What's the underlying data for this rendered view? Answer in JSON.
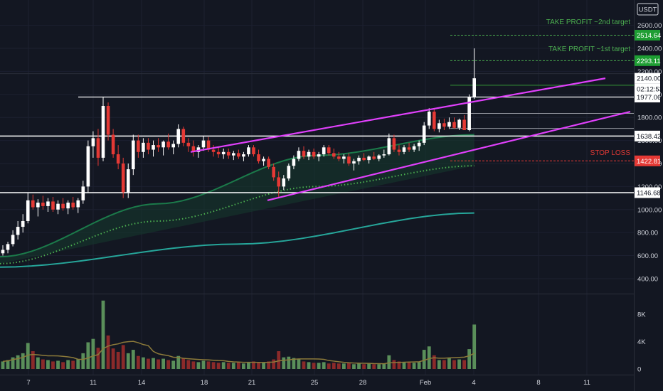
{
  "chart_data": {
    "type": "candlestick",
    "currency_label": "USDT",
    "y_ticks": [
      400,
      600,
      800,
      1000,
      1200,
      1400,
      1600,
      1800,
      2000,
      2200,
      2400,
      2600
    ],
    "y_tick_labels": [
      "400.00",
      "600.00",
      "800.00",
      "1000.00",
      "1200.00",
      "1400.00",
      "1600.00",
      "1800.00",
      "2000.00",
      "2200.00",
      "2400.00",
      "2600.00"
    ],
    "ylim": [
      270,
      2820
    ],
    "x_ticks": [
      "7",
      "11",
      "14",
      "18",
      "21",
      "25",
      "28",
      "Feb",
      "4",
      "8",
      "11"
    ],
    "volume_ticks": [
      "8K",
      "4K",
      "0"
    ],
    "volume_tick_values": [
      8000,
      4000,
      0
    ],
    "price_tags": [
      {
        "value": "2514.64",
        "color": "#1e9e33",
        "text_color": "#ffffff"
      },
      {
        "value": "2293.11",
        "color": "#1e9e33",
        "text_color": "#ffffff"
      },
      {
        "value": "2140.00",
        "color": "#ffffff",
        "text_color": "#131722"
      },
      {
        "value": "02:12:53",
        "color": "#ffffff",
        "text_color": "#131722"
      },
      {
        "value": "1977.06",
        "color": "#ffffff",
        "text_color": "#131722"
      },
      {
        "value": "1638.42",
        "color": "#ffffff",
        "text_color": "#131722"
      },
      {
        "value": "1422.81",
        "color": "#e53935",
        "text_color": "#ffffff"
      },
      {
        "value": "1146.68",
        "color": "#ffffff",
        "text_color": "#131722"
      }
    ],
    "annotations": {
      "take_profit_2": "TAKE PROFIT ~2nd target",
      "take_profit_1": "TAKE PROFIT ~1st target",
      "stop_loss": "STOP LOSS"
    },
    "levels": {
      "take_profit_2": 2514.64,
      "take_profit_1": 2293.11,
      "stop_loss": 1422.81,
      "horizontal_white": [
        1977.06,
        1638.42,
        1146.68
      ],
      "green_line": 2080
    },
    "colors": {
      "background": "#131722",
      "up": "#ffffff",
      "down": "#e53935",
      "channel": "#e040fb",
      "take_profit": "#4caf50",
      "stop_loss": "#e53935",
      "ema_long": "#26a69a",
      "ema_mid": "#1b7a4a",
      "ema_dotted": "#4caf50",
      "volume_up": "#5a8f5a",
      "volume_down": "#8b2a2a"
    },
    "series": [
      {
        "name": "EMA long",
        "values": [
          500,
          700,
          970
        ]
      },
      {
        "name": "EMA mid",
        "values": [
          590,
          1050,
          1470,
          1650
        ]
      },
      {
        "name": "EMA dotted",
        "values": [
          530,
          900,
          1200,
          1380
        ]
      }
    ],
    "candles": [
      [
        620,
        690,
        600,
        650
      ],
      [
        650,
        720,
        620,
        700
      ],
      [
        700,
        820,
        680,
        780
      ],
      [
        780,
        900,
        740,
        850
      ],
      [
        850,
        960,
        800,
        900
      ],
      [
        900,
        1150,
        880,
        1080
      ],
      [
        1080,
        1130,
        1000,
        1020
      ],
      [
        1020,
        1090,
        940,
        1060
      ],
      [
        1060,
        1120,
        1000,
        1030
      ],
      [
        1030,
        1100,
        980,
        1070
      ],
      [
        1070,
        1110,
        980,
        1000
      ],
      [
        1000,
        1080,
        960,
        1050
      ],
      [
        1050,
        1100,
        990,
        1010
      ],
      [
        1010,
        1080,
        960,
        1060
      ],
      [
        1060,
        1110,
        1000,
        1020
      ],
      [
        1020,
        1100,
        970,
        1080
      ],
      [
        1080,
        1250,
        1050,
        1200
      ],
      [
        1200,
        1600,
        1150,
        1550
      ],
      [
        1550,
        1680,
        1450,
        1620
      ],
      [
        1620,
        1700,
        1380,
        1450
      ],
      [
        1450,
        1980,
        1420,
        1900
      ],
      [
        1900,
        1930,
        1600,
        1650
      ],
      [
        1650,
        1700,
        1450,
        1480
      ],
      [
        1480,
        1560,
        1350,
        1400
      ],
      [
        1400,
        1450,
        1100,
        1150
      ],
      [
        1150,
        1400,
        1100,
        1350
      ],
      [
        1350,
        1650,
        1300,
        1600
      ],
      [
        1600,
        1650,
        1450,
        1500
      ],
      [
        1500,
        1620,
        1450,
        1580
      ],
      [
        1580,
        1620,
        1480,
        1520
      ],
      [
        1520,
        1600,
        1460,
        1560
      ],
      [
        1560,
        1620,
        1500,
        1540
      ],
      [
        1540,
        1600,
        1470,
        1590
      ],
      [
        1590,
        1660,
        1520,
        1540
      ],
      [
        1540,
        1600,
        1480,
        1570
      ],
      [
        1570,
        1740,
        1540,
        1700
      ],
      [
        1700,
        1720,
        1550,
        1580
      ],
      [
        1580,
        1620,
        1500,
        1550
      ],
      [
        1550,
        1600,
        1460,
        1500
      ],
      [
        1500,
        1560,
        1450,
        1540
      ],
      [
        1540,
        1640,
        1510,
        1600
      ],
      [
        1600,
        1630,
        1500,
        1520
      ],
      [
        1520,
        1560,
        1460,
        1500
      ],
      [
        1500,
        1540,
        1450,
        1480
      ],
      [
        1480,
        1530,
        1440,
        1500
      ],
      [
        1500,
        1530,
        1440,
        1470
      ],
      [
        1470,
        1510,
        1430,
        1490
      ],
      [
        1490,
        1520,
        1440,
        1460
      ],
      [
        1460,
        1500,
        1420,
        1480
      ],
      [
        1480,
        1560,
        1460,
        1540
      ],
      [
        1540,
        1560,
        1460,
        1480
      ],
      [
        1480,
        1520,
        1400,
        1420
      ],
      [
        1420,
        1460,
        1380,
        1440
      ],
      [
        1440,
        1460,
        1350,
        1370
      ],
      [
        1370,
        1400,
        1250,
        1280
      ],
      [
        1280,
        1330,
        1100,
        1200
      ],
      [
        1200,
        1300,
        1170,
        1270
      ],
      [
        1270,
        1400,
        1250,
        1380
      ],
      [
        1380,
        1470,
        1350,
        1440
      ],
      [
        1440,
        1540,
        1420,
        1510
      ],
      [
        1510,
        1550,
        1440,
        1460
      ],
      [
        1460,
        1520,
        1430,
        1500
      ],
      [
        1500,
        1530,
        1440,
        1460
      ],
      [
        1460,
        1500,
        1420,
        1480
      ],
      [
        1480,
        1560,
        1460,
        1540
      ],
      [
        1540,
        1560,
        1470,
        1490
      ],
      [
        1490,
        1530,
        1440,
        1460
      ],
      [
        1460,
        1500,
        1420,
        1440
      ],
      [
        1440,
        1480,
        1400,
        1460
      ],
      [
        1460,
        1490,
        1380,
        1400
      ],
      [
        1400,
        1440,
        1340,
        1420
      ],
      [
        1420,
        1470,
        1390,
        1450
      ],
      [
        1450,
        1490,
        1420,
        1430
      ],
      [
        1430,
        1470,
        1400,
        1460
      ],
      [
        1460,
        1500,
        1430,
        1440
      ],
      [
        1440,
        1480,
        1420,
        1470
      ],
      [
        1470,
        1520,
        1450,
        1480
      ],
      [
        1480,
        1660,
        1470,
        1620
      ],
      [
        1620,
        1650,
        1500,
        1520
      ],
      [
        1520,
        1560,
        1470,
        1500
      ],
      [
        1500,
        1560,
        1480,
        1540
      ],
      [
        1540,
        1580,
        1500,
        1520
      ],
      [
        1520,
        1570,
        1500,
        1550
      ],
      [
        1550,
        1600,
        1510,
        1580
      ],
      [
        1580,
        1760,
        1560,
        1730
      ],
      [
        1730,
        1880,
        1700,
        1850
      ],
      [
        1850,
        1870,
        1680,
        1700
      ],
      [
        1700,
        1780,
        1670,
        1750
      ],
      [
        1750,
        1790,
        1690,
        1720
      ],
      [
        1720,
        1800,
        1700,
        1760
      ],
      [
        1760,
        1800,
        1700,
        1710
      ],
      [
        1710,
        1790,
        1690,
        1780
      ],
      [
        1780,
        1820,
        1700,
        1690
      ],
      [
        1690,
        2000,
        1680,
        1980
      ],
      [
        1980,
        2400,
        1960,
        2140
      ]
    ],
    "volumes": [
      1100,
      1300,
      1700,
      2000,
      2300,
      3800,
      2600,
      1700,
      1400,
      1300,
      1100,
      1200,
      1000,
      1300,
      1200,
      1400,
      2300,
      3900,
      4400,
      3100,
      10000,
      4900,
      3000,
      2500,
      3500,
      2300,
      2800,
      1900,
      1700,
      1500,
      1600,
      1400,
      1500,
      1300,
      1200,
      1900,
      1600,
      1300,
      1100,
      1000,
      1200,
      1100,
      1000,
      900,
      1000,
      900,
      900,
      1000,
      800,
      1000,
      1100,
      1000,
      900,
      1100,
      1400,
      2600,
      1700,
      1800,
      1600,
      1500,
      1100,
      1000,
      900,
      900,
      1000,
      800,
      900,
      800,
      800,
      900,
      700,
      800,
      700,
      800,
      700,
      700,
      800,
      2000,
      1300,
      1100,
      1000,
      1000,
      900,
      1000,
      2800,
      3300,
      2000,
      1300,
      1300,
      1600,
      1300,
      1400,
      1300,
      2900,
      6500
    ],
    "volume_up": [
      true,
      true,
      true,
      true,
      true,
      true,
      false,
      true,
      false,
      true,
      false,
      true,
      false,
      true,
      false,
      true,
      true,
      true,
      true,
      false,
      true,
      false,
      false,
      false,
      false,
      true,
      true,
      false,
      true,
      false,
      true,
      false,
      true,
      false,
      true,
      true,
      false,
      false,
      false,
      true,
      true,
      false,
      false,
      false,
      true,
      false,
      true,
      false,
      true,
      true,
      false,
      false,
      true,
      false,
      false,
      false,
      true,
      true,
      true,
      true,
      false,
      true,
      false,
      true,
      true,
      false,
      false,
      false,
      true,
      false,
      true,
      true,
      false,
      true,
      false,
      true,
      true,
      true,
      false,
      false,
      true,
      false,
      true,
      true,
      true,
      true,
      false,
      true,
      false,
      true,
      false,
      true,
      false,
      true,
      true
    ]
  }
}
